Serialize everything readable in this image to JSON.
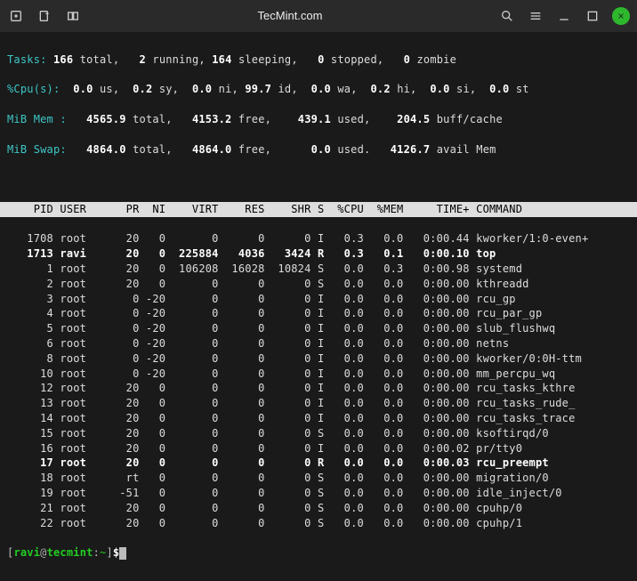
{
  "window": {
    "title": "TecMint.com"
  },
  "summary": {
    "tasks_label": "Tasks:",
    "tasks_total": "166",
    "tasks_total_suffix": " total,",
    "tasks_running": "2",
    "tasks_running_suffix": " running,",
    "tasks_sleeping": "164",
    "tasks_sleeping_suffix": " sleeping,",
    "tasks_stopped": "0",
    "tasks_stopped_suffix": " stopped,",
    "tasks_zombie": "0",
    "tasks_zombie_suffix": " zombie",
    "cpu_label": "%Cpu(s):",
    "cpu_us": "0.0",
    "cpu_us_suffix": " us,",
    "cpu_sy": "0.2",
    "cpu_sy_suffix": " sy,",
    "cpu_ni": "0.0",
    "cpu_ni_suffix": " ni,",
    "cpu_id": "99.7",
    "cpu_id_suffix": " id,",
    "cpu_wa": "0.0",
    "cpu_wa_suffix": " wa,",
    "cpu_hi": "0.2",
    "cpu_hi_suffix": " hi,",
    "cpu_si": "0.0",
    "cpu_si_suffix": " si,",
    "cpu_st": "0.0",
    "cpu_st_suffix": " st",
    "mem_label": "MiB Mem :",
    "mem_total": "4565.9",
    "mem_total_suffix": " total,",
    "mem_free": "4153.2",
    "mem_free_suffix": " free,",
    "mem_used": "439.1",
    "mem_used_suffix": " used,",
    "mem_buff": "204.5",
    "mem_buff_suffix": " buff/cache",
    "swap_label": "MiB Swap:",
    "swap_total": "4864.0",
    "swap_total_suffix": " total,",
    "swap_free": "4864.0",
    "swap_free_suffix": " free,",
    "swap_used": "0.0",
    "swap_used_suffix": " used.",
    "swap_avail": "4126.7",
    "swap_avail_suffix": " avail Mem"
  },
  "columns": {
    "pid": "PID",
    "user": "USER",
    "pr": "PR",
    "ni": "NI",
    "virt": "VIRT",
    "res": "RES",
    "shr": "SHR",
    "s": "S",
    "cpu": "%CPU",
    "mem": "%MEM",
    "time": "TIME+",
    "cmd": "COMMAND"
  },
  "processes": [
    {
      "pid": "1708",
      "user": "root",
      "pr": "20",
      "ni": "0",
      "virt": "0",
      "res": "0",
      "shr": "0",
      "s": "I",
      "cpu": "0.3",
      "mem": "0.0",
      "time": "0:00.44",
      "cmd": "kworker/1:0-even+",
      "bold": false
    },
    {
      "pid": "1713",
      "user": "ravi",
      "pr": "20",
      "ni": "0",
      "virt": "225884",
      "res": "4036",
      "shr": "3424",
      "s": "R",
      "cpu": "0.3",
      "mem": "0.1",
      "time": "0:00.10",
      "cmd": "top",
      "bold": true
    },
    {
      "pid": "1",
      "user": "root",
      "pr": "20",
      "ni": "0",
      "virt": "106208",
      "res": "16028",
      "shr": "10824",
      "s": "S",
      "cpu": "0.0",
      "mem": "0.3",
      "time": "0:00.98",
      "cmd": "systemd",
      "bold": false
    },
    {
      "pid": "2",
      "user": "root",
      "pr": "20",
      "ni": "0",
      "virt": "0",
      "res": "0",
      "shr": "0",
      "s": "S",
      "cpu": "0.0",
      "mem": "0.0",
      "time": "0:00.00",
      "cmd": "kthreadd",
      "bold": false
    },
    {
      "pid": "3",
      "user": "root",
      "pr": "0",
      "ni": "-20",
      "virt": "0",
      "res": "0",
      "shr": "0",
      "s": "I",
      "cpu": "0.0",
      "mem": "0.0",
      "time": "0:00.00",
      "cmd": "rcu_gp",
      "bold": false
    },
    {
      "pid": "4",
      "user": "root",
      "pr": "0",
      "ni": "-20",
      "virt": "0",
      "res": "0",
      "shr": "0",
      "s": "I",
      "cpu": "0.0",
      "mem": "0.0",
      "time": "0:00.00",
      "cmd": "rcu_par_gp",
      "bold": false
    },
    {
      "pid": "5",
      "user": "root",
      "pr": "0",
      "ni": "-20",
      "virt": "0",
      "res": "0",
      "shr": "0",
      "s": "I",
      "cpu": "0.0",
      "mem": "0.0",
      "time": "0:00.00",
      "cmd": "slub_flushwq",
      "bold": false
    },
    {
      "pid": "6",
      "user": "root",
      "pr": "0",
      "ni": "-20",
      "virt": "0",
      "res": "0",
      "shr": "0",
      "s": "I",
      "cpu": "0.0",
      "mem": "0.0",
      "time": "0:00.00",
      "cmd": "netns",
      "bold": false
    },
    {
      "pid": "8",
      "user": "root",
      "pr": "0",
      "ni": "-20",
      "virt": "0",
      "res": "0",
      "shr": "0",
      "s": "I",
      "cpu": "0.0",
      "mem": "0.0",
      "time": "0:00.00",
      "cmd": "kworker/0:0H-ttm",
      "bold": false
    },
    {
      "pid": "10",
      "user": "root",
      "pr": "0",
      "ni": "-20",
      "virt": "0",
      "res": "0",
      "shr": "0",
      "s": "I",
      "cpu": "0.0",
      "mem": "0.0",
      "time": "0:00.00",
      "cmd": "mm_percpu_wq",
      "bold": false
    },
    {
      "pid": "12",
      "user": "root",
      "pr": "20",
      "ni": "0",
      "virt": "0",
      "res": "0",
      "shr": "0",
      "s": "I",
      "cpu": "0.0",
      "mem": "0.0",
      "time": "0:00.00",
      "cmd": "rcu_tasks_kthre",
      "bold": false
    },
    {
      "pid": "13",
      "user": "root",
      "pr": "20",
      "ni": "0",
      "virt": "0",
      "res": "0",
      "shr": "0",
      "s": "I",
      "cpu": "0.0",
      "mem": "0.0",
      "time": "0:00.00",
      "cmd": "rcu_tasks_rude_",
      "bold": false
    },
    {
      "pid": "14",
      "user": "root",
      "pr": "20",
      "ni": "0",
      "virt": "0",
      "res": "0",
      "shr": "0",
      "s": "I",
      "cpu": "0.0",
      "mem": "0.0",
      "time": "0:00.00",
      "cmd": "rcu_tasks_trace",
      "bold": false
    },
    {
      "pid": "15",
      "user": "root",
      "pr": "20",
      "ni": "0",
      "virt": "0",
      "res": "0",
      "shr": "0",
      "s": "S",
      "cpu": "0.0",
      "mem": "0.0",
      "time": "0:00.00",
      "cmd": "ksoftirqd/0",
      "bold": false
    },
    {
      "pid": "16",
      "user": "root",
      "pr": "20",
      "ni": "0",
      "virt": "0",
      "res": "0",
      "shr": "0",
      "s": "I",
      "cpu": "0.0",
      "mem": "0.0",
      "time": "0:00.02",
      "cmd": "pr/tty0",
      "bold": false
    },
    {
      "pid": "17",
      "user": "root",
      "pr": "20",
      "ni": "0",
      "virt": "0",
      "res": "0",
      "shr": "0",
      "s": "R",
      "cpu": "0.0",
      "mem": "0.0",
      "time": "0:00.03",
      "cmd": "rcu_preempt",
      "bold": true
    },
    {
      "pid": "18",
      "user": "root",
      "pr": "rt",
      "ni": "0",
      "virt": "0",
      "res": "0",
      "shr": "0",
      "s": "S",
      "cpu": "0.0",
      "mem": "0.0",
      "time": "0:00.00",
      "cmd": "migration/0",
      "bold": false
    },
    {
      "pid": "19",
      "user": "root",
      "pr": "-51",
      "ni": "0",
      "virt": "0",
      "res": "0",
      "shr": "0",
      "s": "S",
      "cpu": "0.0",
      "mem": "0.0",
      "time": "0:00.00",
      "cmd": "idle_inject/0",
      "bold": false
    },
    {
      "pid": "21",
      "user": "root",
      "pr": "20",
      "ni": "0",
      "virt": "0",
      "res": "0",
      "shr": "0",
      "s": "S",
      "cpu": "0.0",
      "mem": "0.0",
      "time": "0:00.00",
      "cmd": "cpuhp/0",
      "bold": false
    },
    {
      "pid": "22",
      "user": "root",
      "pr": "20",
      "ni": "0",
      "virt": "0",
      "res": "0",
      "shr": "0",
      "s": "S",
      "cpu": "0.0",
      "mem": "0.0",
      "time": "0:00.00",
      "cmd": "cpuhp/1",
      "bold": false
    }
  ],
  "prompt": {
    "open": "[",
    "user": "ravi",
    "at": "@",
    "host": "tecmint",
    "colon": ":",
    "tilde": "~",
    "close": "]",
    "dollar": "$"
  }
}
